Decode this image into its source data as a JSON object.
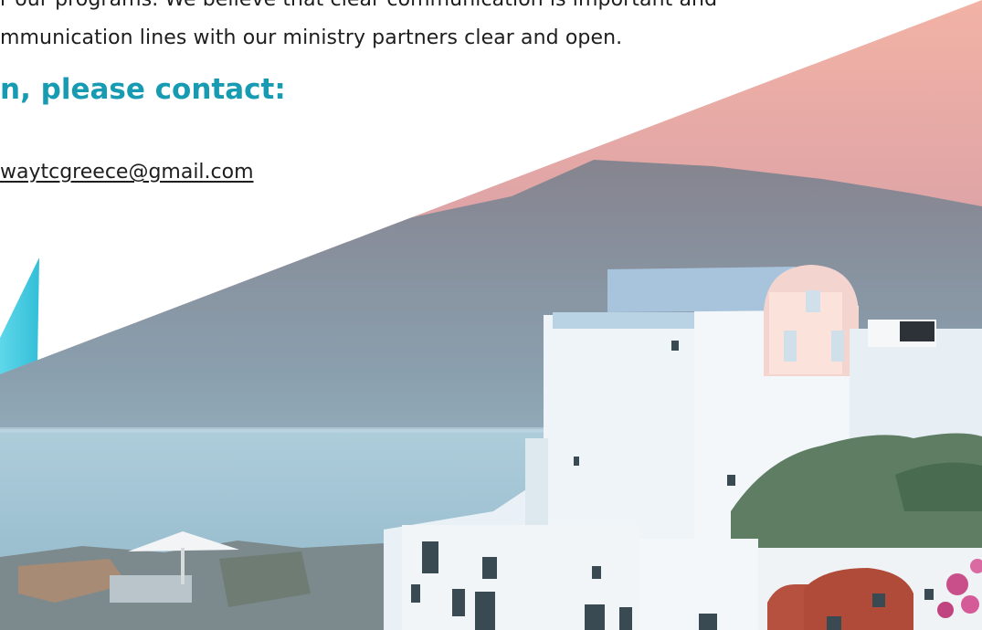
{
  "content": {
    "body_line_1": "r our programs. We believe that clear communication is important and",
    "body_line_2": "mmunication lines with our ministry partners clear and open.",
    "contact_heading": "n, please contact:",
    "email": "waytcgreece@gmail.com"
  },
  "colors": {
    "heading": "#179bb2",
    "body_text": "#1e1e1e",
    "accent_panel": "#3ec7df",
    "background": "#ffffff"
  }
}
